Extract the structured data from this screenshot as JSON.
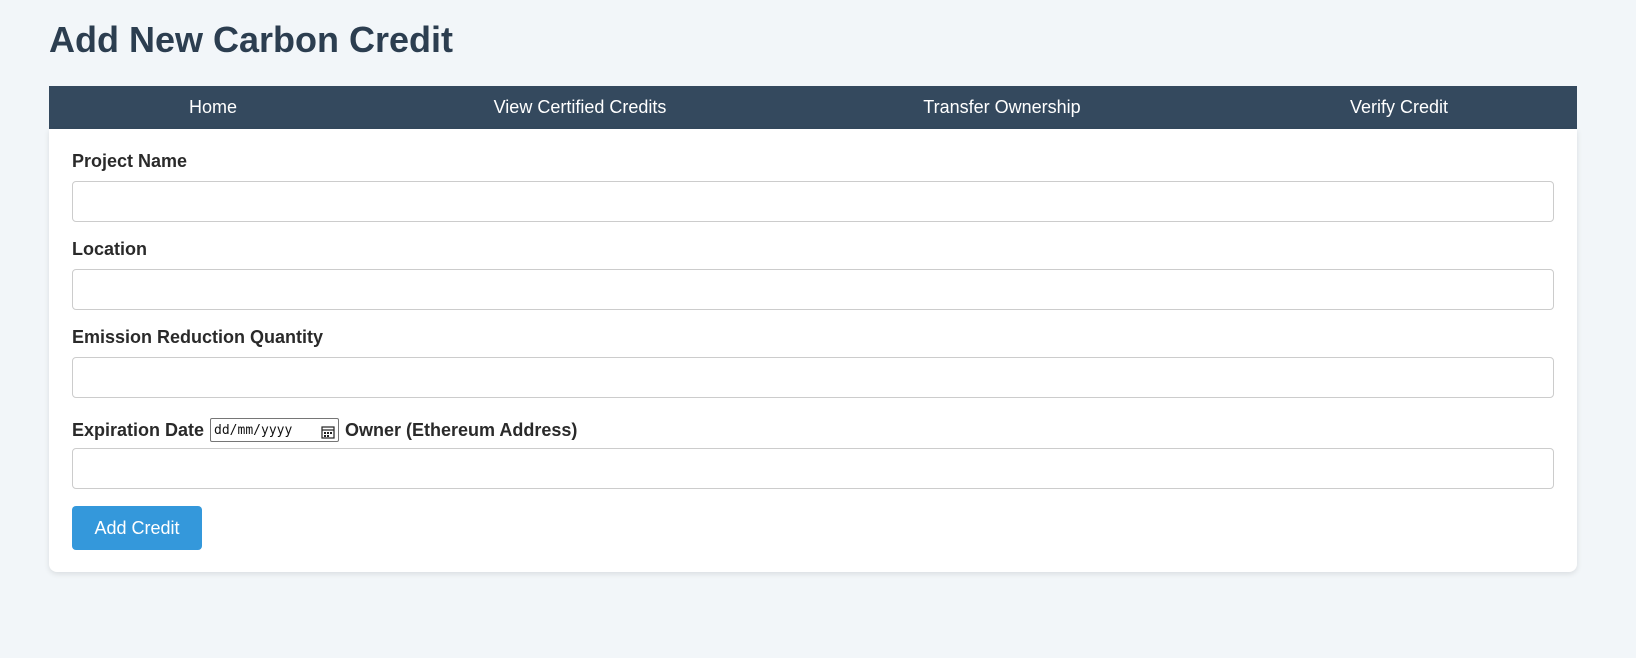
{
  "page": {
    "title": "Add New Carbon Credit"
  },
  "nav": {
    "items": [
      {
        "label": "Home"
      },
      {
        "label": "View Certified Credits"
      },
      {
        "label": "Transfer Ownership"
      },
      {
        "label": "Verify Credit"
      }
    ]
  },
  "form": {
    "project_name": {
      "label": "Project Name",
      "value": ""
    },
    "location": {
      "label": "Location",
      "value": ""
    },
    "emission_reduction_quantity": {
      "label": "Emission Reduction Quantity",
      "value": ""
    },
    "expiration_date": {
      "label": "Expiration Date",
      "placeholder": "dd/mm/yyyy",
      "icon": "calendar-icon"
    },
    "owner": {
      "label": "Owner (Ethereum Address)",
      "value": ""
    },
    "submit_label": "Add Credit"
  },
  "colors": {
    "page_background": "#f2f6f9",
    "title_text": "#2c3e50",
    "nav_background": "#34495e",
    "button_background": "#3498db"
  }
}
